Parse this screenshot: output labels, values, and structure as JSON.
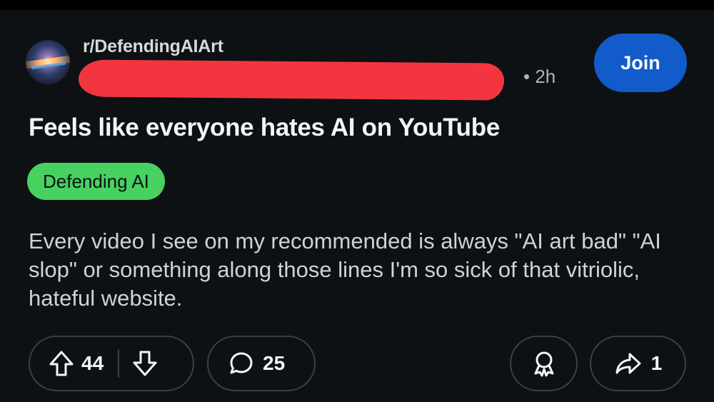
{
  "post": {
    "subreddit": "r/DefendingAIArt",
    "time": "• 2h",
    "join_label": "Join",
    "title": "Feels like everyone hates AI on YouTube",
    "flair": "Defending AI",
    "body": "Every video I see on my recommended is always \"AI art bad\" \"AI slop\" or something along those lines I'm so sick of that vitriolic, hateful website."
  },
  "actions": {
    "upvotes": "44",
    "comments": "25",
    "shares": "1"
  },
  "colors": {
    "background": "#0e1113",
    "join_button": "#115bca",
    "flair": "#46d160",
    "redaction": "#f3353f"
  },
  "icons": {
    "upvote": "upvote-arrow-icon",
    "downvote": "downvote-arrow-icon",
    "comment": "comment-bubble-icon",
    "award": "award-icon",
    "share": "share-arrow-icon"
  }
}
